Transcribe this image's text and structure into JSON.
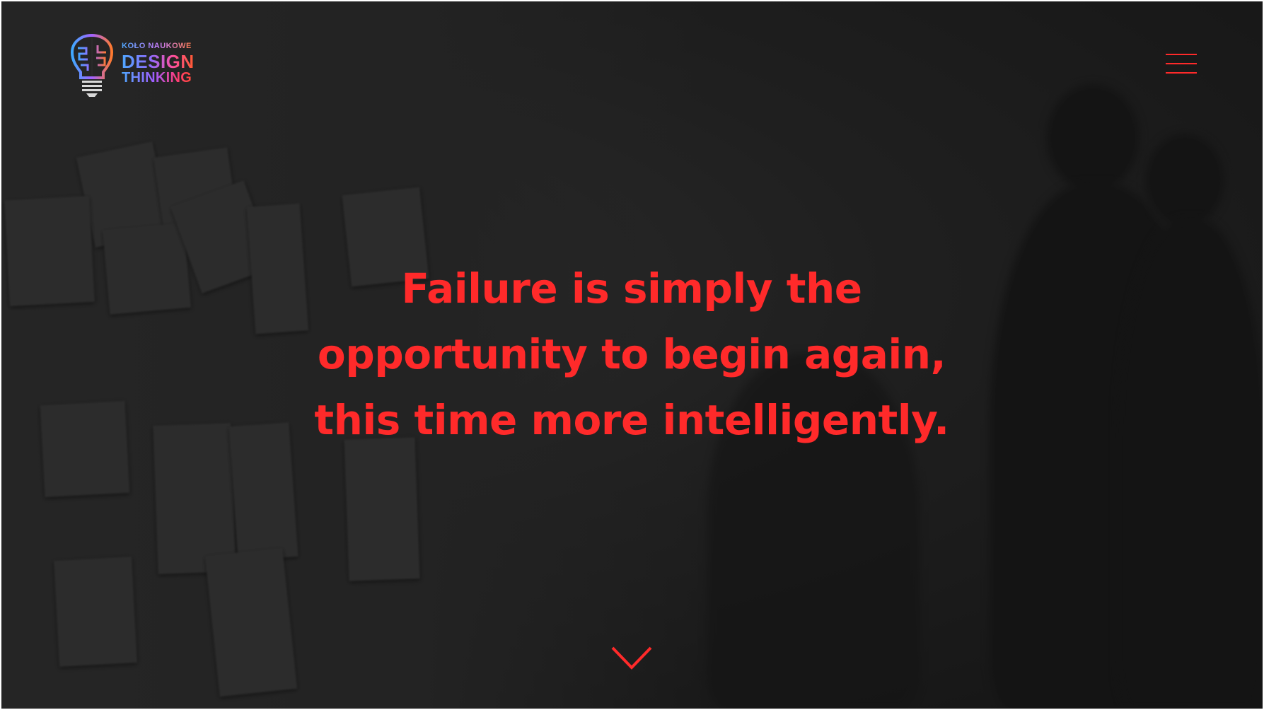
{
  "header": {
    "logo": {
      "small_text": "KOŁO NAUKOWE",
      "title_line1": "DESIGN",
      "title_line2": "THINKING",
      "icon": "brain-lightbulb-icon"
    },
    "menu": {
      "icon": "hamburger-menu-icon",
      "color": "#ff2a2a"
    }
  },
  "hero": {
    "quote_lines": [
      "Failure is simply the",
      "opportunity to begin again,",
      "this time more intelligently."
    ],
    "quote_color": "#ff2a2a",
    "scroll_icon": "chevron-down-icon"
  }
}
